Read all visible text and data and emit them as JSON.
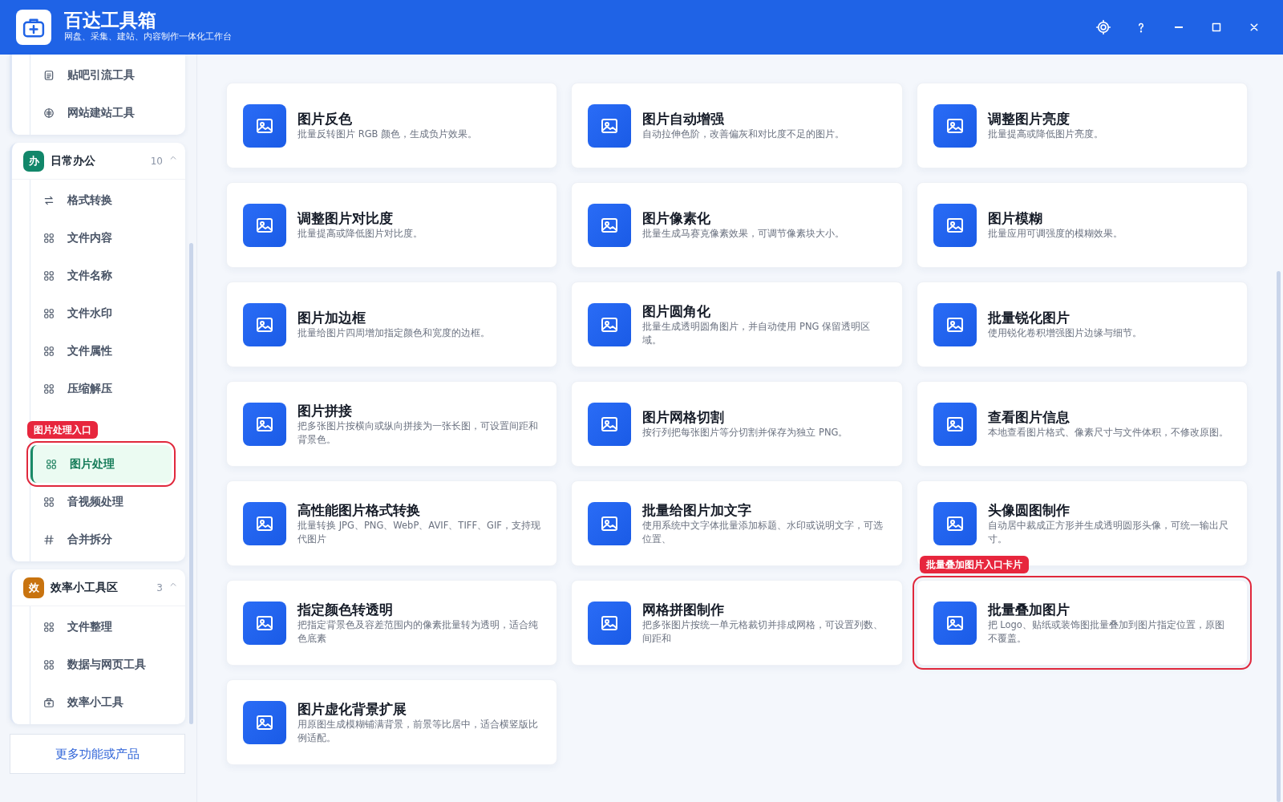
{
  "header": {
    "title": "百达工具箱",
    "subtitle": "网盘、采集、建站、内容制作一体化工作台"
  },
  "sidebar": {
    "groups": [
      {
        "items": [
          {
            "label": "贴吧引流工具",
            "kind": "doc",
            "selected": false
          },
          {
            "label": "网站建站工具",
            "kind": "globe",
            "selected": false
          }
        ]
      },
      {
        "title": "日常办公",
        "badge": "办",
        "color": "#12876a",
        "count": "10",
        "expanded": true,
        "items": [
          {
            "label": "格式转换",
            "kind": "swap",
            "selected": false
          },
          {
            "label": "文件内容",
            "kind": "grid",
            "selected": false
          },
          {
            "label": "文件名称",
            "kind": "grid",
            "selected": false
          },
          {
            "label": "文件水印",
            "kind": "grid",
            "selected": false
          },
          {
            "label": "文件属性",
            "kind": "grid",
            "selected": false
          },
          {
            "label": "压缩解压",
            "kind": "grid",
            "selected": false
          },
          {
            "label": "图片处理",
            "kind": "grid",
            "selected": true,
            "annotation": "图片处理入口"
          },
          {
            "label": "音视频处理",
            "kind": "grid",
            "selected": false
          },
          {
            "label": "合并拆分",
            "kind": "hash",
            "selected": false
          }
        ]
      },
      {
        "title": "效率小工具区",
        "badge": "效",
        "color": "#c8730f",
        "count": "3",
        "expanded": true,
        "items": [
          {
            "label": "文件整理",
            "kind": "grid",
            "selected": false
          },
          {
            "label": "数据与网页工具",
            "kind": "grid",
            "selected": false
          },
          {
            "label": "效率小工具",
            "kind": "box",
            "selected": false
          }
        ]
      }
    ],
    "more_button": "更多功能或产品"
  },
  "cards": [
    {
      "title": "图片反色",
      "description": "批量反转图片 RGB 颜色，生成负片效果。"
    },
    {
      "title": "图片自动增强",
      "description": "自动拉伸色阶，改善偏灰和对比度不足的图片。"
    },
    {
      "title": "调整图片亮度",
      "description": "批量提高或降低图片亮度。"
    },
    {
      "title": "调整图片对比度",
      "description": "批量提高或降低图片对比度。"
    },
    {
      "title": "图片像素化",
      "description": "批量生成马赛克像素效果，可调节像素块大小。"
    },
    {
      "title": "图片模糊",
      "description": "批量应用可调强度的模糊效果。"
    },
    {
      "title": "图片加边框",
      "description": "批量给图片四周增加指定颜色和宽度的边框。"
    },
    {
      "title": "图片圆角化",
      "description": "批量生成透明圆角图片，并自动使用 PNG 保留透明区域。"
    },
    {
      "title": "批量锐化图片",
      "description": "使用锐化卷积增强图片边缘与细节。"
    },
    {
      "title": "图片拼接",
      "description": "把多张图片按横向或纵向拼接为一张长图，可设置间距和背景色。"
    },
    {
      "title": "图片网格切割",
      "description": "按行列把每张图片等分切割并保存为独立 PNG。"
    },
    {
      "title": "查看图片信息",
      "description": "本地查看图片格式、像素尺寸与文件体积，不修改原图。"
    },
    {
      "title": "高性能图片格式转换",
      "description": "批量转换 JPG、PNG、WebP、AVIF、TIFF、GIF，支持现代图片"
    },
    {
      "title": "批量给图片加文字",
      "description": "使用系统中文字体批量添加标题、水印或说明文字，可选位置、"
    },
    {
      "title": "头像圆图制作",
      "description": "自动居中裁成正方形并生成透明圆形头像，可统一输出尺寸。"
    },
    {
      "title": "指定颜色转透明",
      "description": "把指定背景色及容差范围内的像素批量转为透明，适合纯色底素"
    },
    {
      "title": "网格拼图制作",
      "description": "把多张图片按统一单元格裁切并排成网格，可设置列数、间距和"
    },
    {
      "title": "批量叠加图片",
      "description": "把 Logo、贴纸或装饰图批量叠加到图片指定位置，原图不覆盖。",
      "annotation": "批量叠加图片入口卡片"
    },
    {
      "title": "图片虚化背景扩展",
      "description": "用原图生成模糊铺满背景，前景等比居中，适合横竖版比例适配。"
    }
  ]
}
